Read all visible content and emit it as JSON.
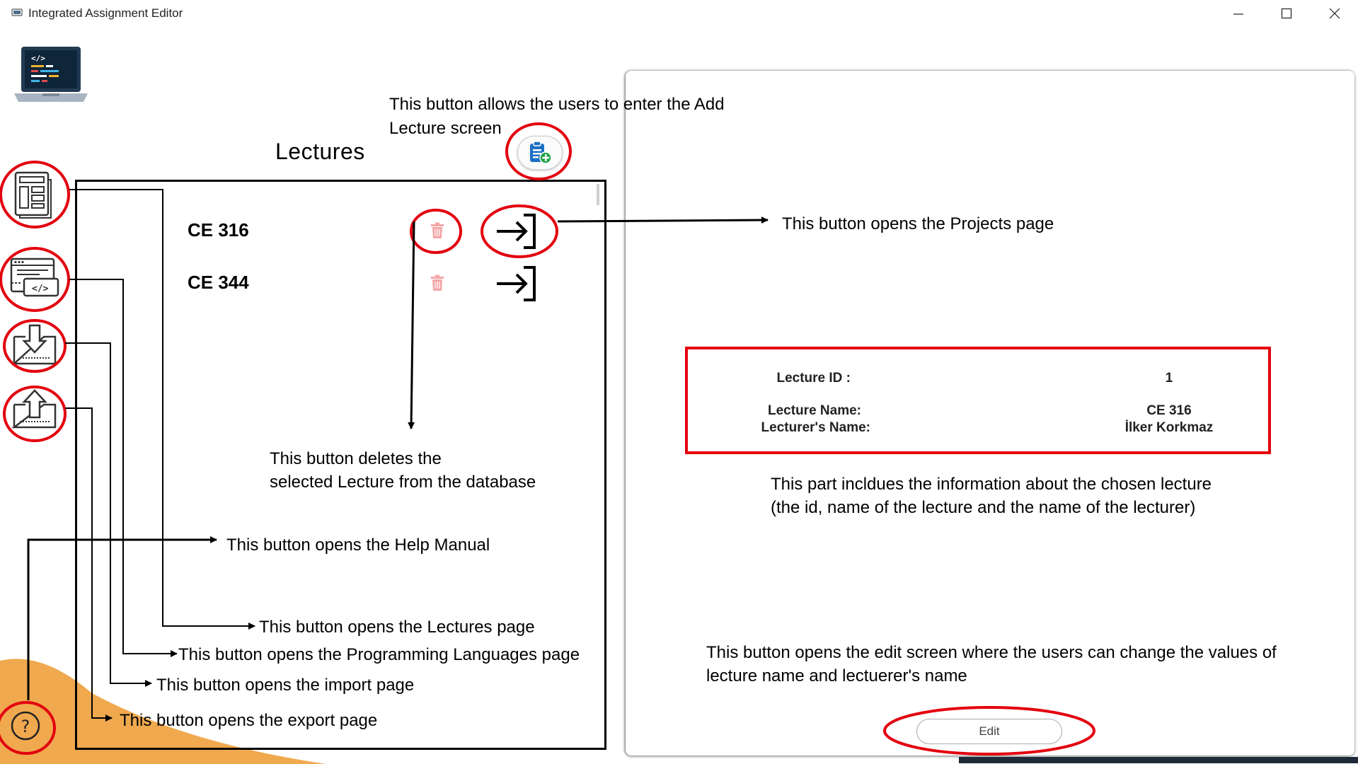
{
  "window": {
    "title": "Integrated Assignment Editor",
    "controls": [
      "—",
      "☐",
      "✕"
    ]
  },
  "lectures": {
    "heading": "Lectures",
    "items": [
      {
        "label": "CE 316"
      },
      {
        "label": "CE 344"
      }
    ]
  },
  "details": {
    "id_label": "Lecture ID :",
    "id_value": "1",
    "name_label": "Lecture Name:",
    "name_value": "CE 316",
    "lecturer_label": "Lecturer's Name:",
    "lecturer_value": "İlker Korkmaz",
    "edit_label": "Edit"
  },
  "annotations": {
    "add_lecture_1": "This button allows the users to  enter the Add",
    "add_lecture_2": "Lecture screen",
    "projects": "This button opens the Projects page",
    "delete_1": "This button deletes the",
    "delete_2": "selected Lecture from the database",
    "info_1": "This part incldues the information about the chosen lecture",
    "info_2": "(the id, name of the lecture and the name of the lecturer)",
    "help": "This button opens the Help Manual",
    "lectures_page": "This button opens the Lectures page",
    "languages_page": "This button opens the Programming Languages page",
    "import_page": "This button opens the import page",
    "export_page": "This button opens the export page",
    "edit_1": "This button opens the edit screen where the users can change the values of",
    "edit_2": "lecture name and lectuerer's name"
  },
  "colors": {
    "highlight_red": "#e3000f",
    "accent_orange": "#f0a94e",
    "trash_pink": "#f4a6a6",
    "add_icon_blue": "#1d6fc4",
    "add_icon_green": "#22a34a"
  }
}
